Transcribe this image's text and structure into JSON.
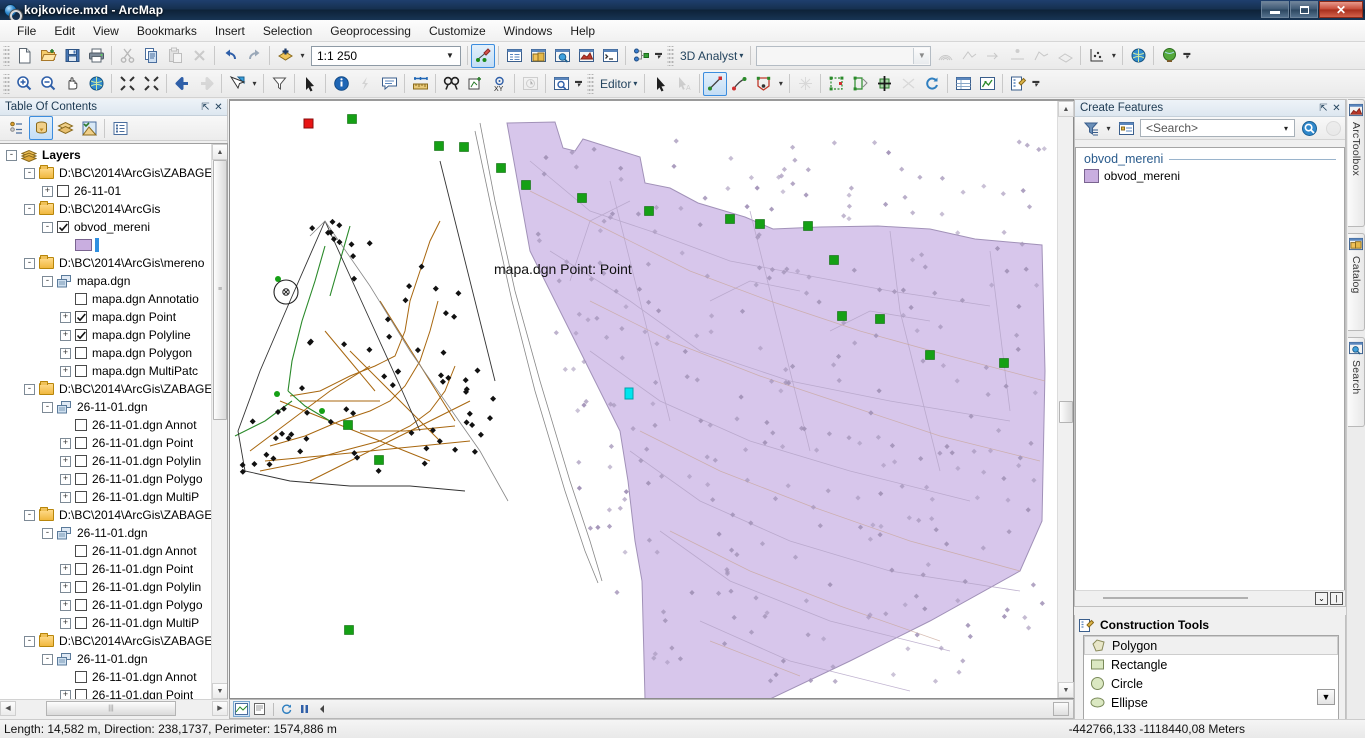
{
  "window": {
    "title": "kojkovice.mxd - ArcMap",
    "app_icon": "arcmap-globe-icon",
    "minimize": "–",
    "maximize": "❐",
    "close": "✕"
  },
  "menubar": {
    "items": [
      "File",
      "Edit",
      "View",
      "Bookmarks",
      "Insert",
      "Selection",
      "Geoprocessing",
      "Customize",
      "Windows",
      "Help"
    ]
  },
  "standard_toolbar": {
    "scale_value": "1:1 250",
    "analyst_label": "3D Analyst",
    "analyst_layer": "",
    "buttons": [
      {
        "name": "new-map-icon",
        "title": "New"
      },
      {
        "name": "open-icon",
        "title": "Open"
      },
      {
        "name": "save-icon",
        "title": "Save"
      },
      {
        "name": "print-icon",
        "title": "Print"
      },
      {
        "name": "cut-icon",
        "title": "Cut"
      },
      {
        "name": "copy-icon",
        "title": "Copy"
      },
      {
        "name": "paste-icon",
        "title": "Paste"
      },
      {
        "name": "delete-icon",
        "title": "Delete"
      },
      {
        "name": "undo-icon",
        "title": "Undo"
      },
      {
        "name": "redo-icon",
        "title": "Redo"
      },
      {
        "name": "add-data-icon",
        "title": "Add Data"
      },
      {
        "name": "editor-toolbar-icon",
        "title": "Editor Toolbar"
      },
      {
        "name": "table-of-contents-icon",
        "title": "Table Of Contents"
      },
      {
        "name": "catalog-window-icon",
        "title": "Catalog"
      },
      {
        "name": "search-window-icon",
        "title": "Search"
      },
      {
        "name": "arctoolbox-icon",
        "title": "ArcToolbox"
      },
      {
        "name": "python-window-icon",
        "title": "Python Window"
      },
      {
        "name": "model-builder-icon",
        "title": "ModelBuilder"
      }
    ]
  },
  "tools_toolbar": {
    "editor_label": "Editor",
    "buttons": [
      {
        "name": "zoom-in-icon",
        "title": "Zoom In"
      },
      {
        "name": "zoom-out-icon",
        "title": "Zoom Out"
      },
      {
        "name": "pan-icon",
        "title": "Pan"
      },
      {
        "name": "full-extent-icon",
        "title": "Full Extent"
      },
      {
        "name": "fixed-zoom-in-icon",
        "title": "Fixed Zoom In"
      },
      {
        "name": "fixed-zoom-out-icon",
        "title": "Fixed Zoom Out"
      },
      {
        "name": "go-back-extent-icon",
        "title": "Go Back To Previous Extent"
      },
      {
        "name": "go-next-extent-icon",
        "title": "Go To Next Extent"
      },
      {
        "name": "select-features-icon",
        "title": "Select Features"
      },
      {
        "name": "clear-selection-icon",
        "title": "Clear Selected Features"
      },
      {
        "name": "select-elements-icon",
        "title": "Select Elements"
      },
      {
        "name": "identify-icon",
        "title": "Identify"
      },
      {
        "name": "hyperlink-icon",
        "title": "Hyperlink"
      },
      {
        "name": "html-popup-icon",
        "title": "HTML Popup"
      },
      {
        "name": "measure-icon",
        "title": "Measure"
      },
      {
        "name": "find-icon",
        "title": "Find"
      },
      {
        "name": "find-route-icon",
        "title": "Find Route"
      },
      {
        "name": "go-to-xy-icon",
        "title": "Go To XY"
      },
      {
        "name": "time-slider-icon",
        "title": "Time Slider"
      },
      {
        "name": "create-viewer-icon",
        "title": "Create Viewer Window"
      },
      {
        "name": "edit-tool-icon",
        "title": "Edit Tool"
      },
      {
        "name": "edit-annotation-icon",
        "title": "Edit Annotation Tool"
      },
      {
        "name": "straight-segment-icon",
        "title": "Straight Segment"
      },
      {
        "name": "midpoint-icon",
        "title": "Midpoint"
      },
      {
        "name": "trace-icon",
        "title": "Trace"
      },
      {
        "name": "sketch-properties-icon",
        "title": "Sketch Properties"
      },
      {
        "name": "edit-vertices-icon",
        "title": "Edit Vertices"
      },
      {
        "name": "reshape-feature-icon",
        "title": "Reshape Feature Tool"
      },
      {
        "name": "cut-polygons-icon",
        "title": "Cut Polygons Tool"
      },
      {
        "name": "split-tool-icon",
        "title": "Split Tool"
      },
      {
        "name": "rotate-icon",
        "title": "Rotate Tool"
      },
      {
        "name": "attributes-icon",
        "title": "Attributes"
      },
      {
        "name": "sketch-summary-icon",
        "title": "Sketch Summary"
      },
      {
        "name": "create-features-icon",
        "title": "Create Features"
      }
    ]
  },
  "toc": {
    "title": "Table Of Contents",
    "pin": "⌐",
    "close": "✕",
    "toolbar_buttons": [
      {
        "name": "list-by-drawing-order-icon"
      },
      {
        "name": "list-by-source-icon"
      },
      {
        "name": "list-by-visibility-icon"
      },
      {
        "name": "list-by-selection-icon"
      },
      {
        "name": "options-icon"
      }
    ],
    "tree": [
      {
        "indent": 0,
        "toggle": "-",
        "icon": "layers-icon",
        "label": "Layers",
        "bold": true
      },
      {
        "indent": 1,
        "toggle": "-",
        "icon": "folder-icon",
        "label": "D:\\BC\\2014\\ArcGis\\ZABAGE"
      },
      {
        "indent": 2,
        "toggle": "+",
        "icon": "checkbox-off",
        "label": "26-11-01"
      },
      {
        "indent": 1,
        "toggle": "-",
        "icon": "folder-icon",
        "label": "D:\\BC\\2014\\ArcGis"
      },
      {
        "indent": 2,
        "toggle": "-",
        "icon": "checkbox-on",
        "label": "obvod_mereni"
      },
      {
        "indent": 3,
        "toggle": "none",
        "icon": "symbol-swatch",
        "label": ""
      },
      {
        "indent": 1,
        "toggle": "-",
        "icon": "folder-icon",
        "label": "D:\\BC\\2014\\ArcGis\\mereno"
      },
      {
        "indent": 2,
        "toggle": "-",
        "icon": "dgn-icon",
        "label": "mapa.dgn"
      },
      {
        "indent": 3,
        "toggle": "none",
        "icon": "checkbox-off",
        "label": "mapa.dgn Annotatio"
      },
      {
        "indent": 3,
        "toggle": "+",
        "icon": "checkbox-on",
        "label": "mapa.dgn Point"
      },
      {
        "indent": 3,
        "toggle": "+",
        "icon": "checkbox-on",
        "label": "mapa.dgn Polyline"
      },
      {
        "indent": 3,
        "toggle": "+",
        "icon": "checkbox-off",
        "label": "mapa.dgn Polygon"
      },
      {
        "indent": 3,
        "toggle": "+",
        "icon": "checkbox-off",
        "label": "mapa.dgn MultiPatc"
      },
      {
        "indent": 1,
        "toggle": "-",
        "icon": "folder-icon",
        "label": "D:\\BC\\2014\\ArcGis\\ZABAGE"
      },
      {
        "indent": 2,
        "toggle": "-",
        "icon": "dgn-icon",
        "label": "26-11-01.dgn"
      },
      {
        "indent": 3,
        "toggle": "none",
        "icon": "checkbox-off",
        "label": "26-11-01.dgn Annot"
      },
      {
        "indent": 3,
        "toggle": "+",
        "icon": "checkbox-off",
        "label": "26-11-01.dgn Point"
      },
      {
        "indent": 3,
        "toggle": "+",
        "icon": "checkbox-off",
        "label": "26-11-01.dgn Polylin"
      },
      {
        "indent": 3,
        "toggle": "+",
        "icon": "checkbox-off",
        "label": "26-11-01.dgn Polygo"
      },
      {
        "indent": 3,
        "toggle": "+",
        "icon": "checkbox-off",
        "label": "26-11-01.dgn MultiP"
      },
      {
        "indent": 1,
        "toggle": "-",
        "icon": "folder-icon",
        "label": "D:\\BC\\2014\\ArcGis\\ZABAGE"
      },
      {
        "indent": 2,
        "toggle": "-",
        "icon": "dgn-icon",
        "label": "26-11-01.dgn"
      },
      {
        "indent": 3,
        "toggle": "none",
        "icon": "checkbox-off",
        "label": "26-11-01.dgn Annot"
      },
      {
        "indent": 3,
        "toggle": "+",
        "icon": "checkbox-off",
        "label": "26-11-01.dgn Point"
      },
      {
        "indent": 3,
        "toggle": "+",
        "icon": "checkbox-off",
        "label": "26-11-01.dgn Polylin"
      },
      {
        "indent": 3,
        "toggle": "+",
        "icon": "checkbox-off",
        "label": "26-11-01.dgn Polygo"
      },
      {
        "indent": 3,
        "toggle": "+",
        "icon": "checkbox-off",
        "label": "26-11-01.dgn MultiP"
      },
      {
        "indent": 1,
        "toggle": "-",
        "icon": "folder-icon",
        "label": "D:\\BC\\2014\\ArcGis\\ZABAGE"
      },
      {
        "indent": 2,
        "toggle": "-",
        "icon": "dgn-icon",
        "label": "26-11-01.dgn"
      },
      {
        "indent": 3,
        "toggle": "none",
        "icon": "checkbox-off",
        "label": "26-11-01.dgn Annot"
      },
      {
        "indent": 3,
        "toggle": "+",
        "icon": "checkbox-off",
        "label": "26-11-01.dgn Point"
      }
    ]
  },
  "map": {
    "tooltip": "mapa.dgn Point: Point",
    "colors": {
      "polygon_fill": "#d5c4ea",
      "polygon_outline": "#9d8cb5",
      "vertex_green": "#15a015",
      "start_vertex_red": "#e81414",
      "selected_vertex_cyan": "#00e5ee",
      "road_brown": "#a8670f",
      "line_black": "#000000"
    },
    "bottom_bar": {
      "data_view_label": "data-view",
      "layout_view_label": "layout-view",
      "refresh_label": "refresh",
      "pause_label": "pause"
    }
  },
  "create_features": {
    "title": "Create Features",
    "pin": "⌐",
    "close": "✕",
    "search_placeholder": "<Search>",
    "group_name": "obvod_mereni",
    "templates": [
      {
        "label": "obvod_mereni",
        "swatch": "#c9aee0"
      }
    ]
  },
  "construction_tools": {
    "title": "Construction Tools",
    "items": [
      {
        "label": "Polygon",
        "icon": "polygon-icon",
        "selected": true
      },
      {
        "label": "Rectangle",
        "icon": "rectangle-icon",
        "selected": false
      },
      {
        "label": "Circle",
        "icon": "circle-icon",
        "selected": false
      },
      {
        "label": "Ellipse",
        "icon": "ellipse-icon",
        "selected": false
      }
    ]
  },
  "side_tabs": [
    {
      "label": "ArcToolbox",
      "icon": "arctoolbox-icon"
    },
    {
      "label": "Catalog",
      "icon": "catalog-icon"
    },
    {
      "label": "Search",
      "icon": "search-icon"
    }
  ],
  "statusbar": {
    "message": "Length: 14,582 m, Direction: 238,1737, Perimeter: 1574,886 m",
    "coordinates": "-442766,133  -1118440,08 Meters"
  }
}
